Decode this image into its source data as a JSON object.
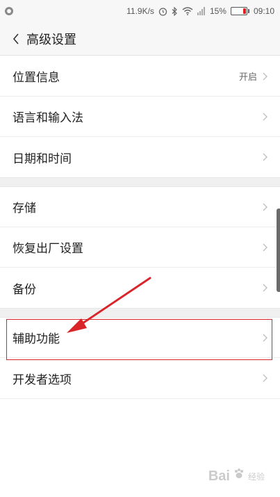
{
  "status_bar": {
    "speed": "11.9K/s",
    "battery_percent": "15%",
    "time": "09:10"
  },
  "header": {
    "title": "高级设置"
  },
  "sections": [
    {
      "items": [
        {
          "label": "位置信息",
          "value": "开启"
        },
        {
          "label": "语言和输入法",
          "value": ""
        },
        {
          "label": "日期和时间",
          "value": ""
        }
      ]
    },
    {
      "items": [
        {
          "label": "存储",
          "value": ""
        },
        {
          "label": "恢复出厂设置",
          "value": ""
        },
        {
          "label": "备份",
          "value": ""
        }
      ]
    },
    {
      "items": [
        {
          "label": "辅助功能",
          "value": ""
        },
        {
          "label": "开发者选项",
          "value": ""
        }
      ]
    }
  ],
  "annotation": {
    "highlight_color": "#d9252a"
  },
  "watermark": {
    "text": "Bai",
    "suffix": "经验"
  }
}
